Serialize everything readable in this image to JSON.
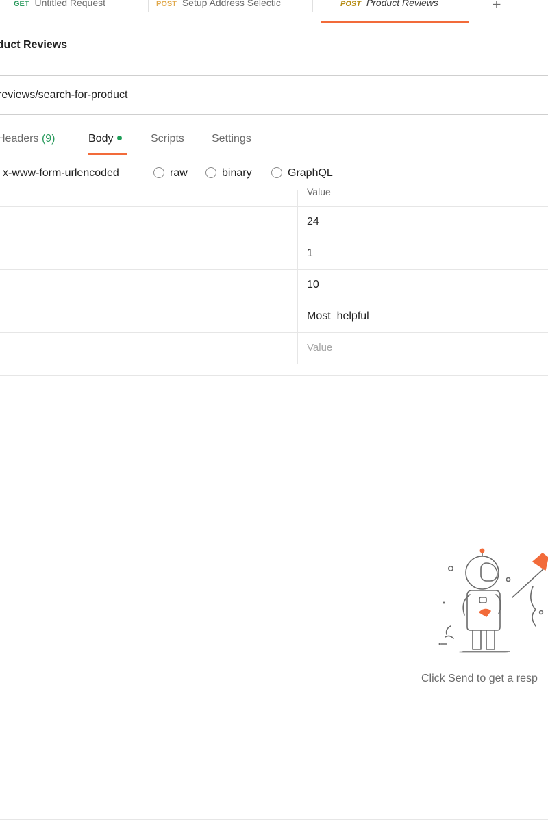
{
  "tabs": [
    {
      "method": "GET",
      "name": "Untitled Request"
    },
    {
      "method": "POST",
      "name": "Setup Address Selectic"
    },
    {
      "method": "POST",
      "name": "Product Reviews"
    }
  ],
  "new_tab_symbol": "+",
  "request": {
    "title": "oduct Reviews",
    "url": "reviews/search-for-product"
  },
  "subtabs": {
    "headers_label": "Headers",
    "headers_count": "(9)",
    "body": "Body",
    "scripts": "Scripts",
    "settings": "Settings"
  },
  "body_types": {
    "urlencoded": "x-www-form-urlencoded",
    "raw": "raw",
    "binary": "binary",
    "graphql": "GraphQL"
  },
  "table": {
    "value_header": "Value",
    "rows": [
      "24",
      "1",
      "10",
      "Most_helpful"
    ],
    "placeholder": "Value"
  },
  "response": {
    "empty_message": "Click Send to get a resp"
  },
  "colors": {
    "accent": "#f26b3a",
    "get": "#2b9b5e",
    "post": "#e0a84a",
    "body_dot": "#1f9e58"
  }
}
